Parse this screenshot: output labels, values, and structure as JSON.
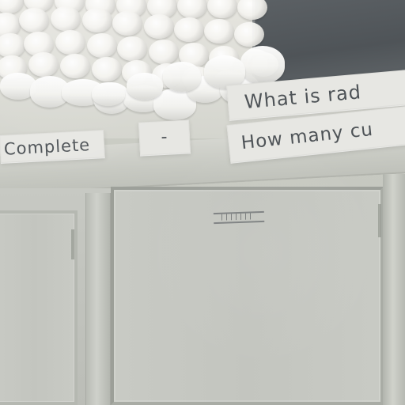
{
  "shelf_labels": {
    "complete": "Complete",
    "dash": "-",
    "question_1": "What is rad",
    "question_2": "How many cu"
  },
  "colors": {
    "cabinet": "#c7c9c3",
    "label_background": "#e7e7e3",
    "label_text": "#4e5357",
    "dark_wall": "#54595d",
    "cups": "#f4f3ef"
  }
}
